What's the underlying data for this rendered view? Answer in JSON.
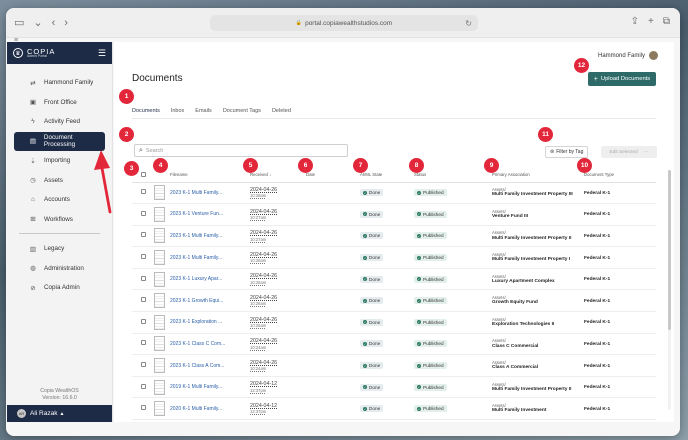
{
  "browser": {
    "url": "portal.copiawealthstudios.com"
  },
  "sidebar": {
    "brand": "COPIA",
    "brand_sub": "Admin Portal",
    "items": [
      {
        "label": "Hammond Family",
        "icon": "arrows-swap-icon"
      },
      {
        "label": "Front Office",
        "icon": "briefcase-icon"
      },
      {
        "label": "Activity Feed",
        "icon": "activity-icon"
      },
      {
        "label": "Document Processing",
        "icon": "document-icon",
        "active": true
      },
      {
        "label": "Importing",
        "icon": "import-icon"
      },
      {
        "label": "Assets",
        "icon": "clock-icon"
      },
      {
        "label": "Accounts",
        "icon": "bank-icon"
      },
      {
        "label": "Workflows",
        "icon": "workflow-icon"
      },
      {
        "label": "Legacy",
        "icon": "book-icon"
      },
      {
        "label": "Administration",
        "icon": "globe-icon"
      },
      {
        "label": "Copia Admin",
        "icon": "compass-icon"
      }
    ],
    "version_line1": "Copia WealthOS",
    "version_line2": "Version: 16.6.0",
    "user_name": "Ali Razak",
    "user_initials": "AR"
  },
  "header": {
    "user": "Hammond Family"
  },
  "main": {
    "title": "Documents",
    "upload_label": "Upload Documents",
    "tabs": [
      "Documents",
      "Inbox",
      "Emails",
      "Document Tags",
      "Deleted"
    ],
    "search_placeholder": "Search",
    "filter_label": "Filter by Tag",
    "edit_label": "Edit Selected"
  },
  "table": {
    "columns": [
      "Filename",
      "Received",
      "Date",
      "AI/ML State",
      "Status",
      "Primary Association",
      "Document Type"
    ],
    "rows": [
      {
        "filename": "2023 K-1 Multi Family...",
        "date": "2024-04-26",
        "time": "10:28am",
        "state": "Done",
        "status": "Published",
        "assoc_type": "Assets/",
        "assoc_name": "Multi Family Investment Property III",
        "doc_type": "Federal K-1"
      },
      {
        "filename": "2023 K-1 Venture Fun...",
        "date": "2024-04-26",
        "time": "10:27am",
        "state": "Done",
        "status": "Published",
        "assoc_type": "Assets/",
        "assoc_name": "Venture Fund III",
        "doc_type": "Federal K-1"
      },
      {
        "filename": "2023 K-1 Multi Family...",
        "date": "2024-04-26",
        "time": "10:27am",
        "state": "Done",
        "status": "Published",
        "assoc_type": "Assets/",
        "assoc_name": "Multi Family Investment Property II",
        "doc_type": "Federal K-1"
      },
      {
        "filename": "2023 K-1 Multi Family...",
        "date": "2024-04-26",
        "time": "10:26am",
        "state": "Done",
        "status": "Published",
        "assoc_type": "Assets/",
        "assoc_name": "Multi Family Investment Property I",
        "doc_type": "Federal K-1"
      },
      {
        "filename": "2023 K-1 Luxury Apar...",
        "date": "2024-04-26",
        "time": "10:26am",
        "state": "Done",
        "status": "Published",
        "assoc_type": "Assets/",
        "assoc_name": "Luxury Apartment Complex",
        "doc_type": "Federal K-1"
      },
      {
        "filename": "2023 K-1 Growth Equi...",
        "date": "2024-04-26",
        "time": "10:26am",
        "state": "Done",
        "status": "Published",
        "assoc_type": "Assets/",
        "assoc_name": "Growth Equity Fund",
        "doc_type": "Federal K-1"
      },
      {
        "filename": "2023 K-1 Exploration ...",
        "date": "2024-04-26",
        "time": "10:25am",
        "state": "Done",
        "status": "Published",
        "assoc_type": "Assets/",
        "assoc_name": "Exploration Technologies II",
        "doc_type": "Federal K-1"
      },
      {
        "filename": "2023 K-1 Class C Com...",
        "date": "2024-04-26",
        "time": "10:24am",
        "state": "Done",
        "status": "Published",
        "assoc_type": "Assets/",
        "assoc_name": "Class C Commercial",
        "doc_type": "Federal K-1"
      },
      {
        "filename": "2023 K-1 Class A Com...",
        "date": "2024-04-26",
        "time": "10:24am",
        "state": "Done",
        "status": "Published",
        "assoc_type": "Assets/",
        "assoc_name": "Class A Commercial",
        "doc_type": "Federal K-1"
      },
      {
        "filename": "2019 K-1 Multi Family...",
        "date": "2024-04-12",
        "time": "12:37pm",
        "state": "Done",
        "status": "Published",
        "assoc_type": "Assets/",
        "assoc_name": "Multi Family Investment Property II",
        "doc_type": "Federal K-1"
      },
      {
        "filename": "2020 K-1 Multi Family...",
        "date": "2024-04-12",
        "time": "12:37pm",
        "state": "Done",
        "status": "Published",
        "assoc_type": "Assets/",
        "assoc_name": "Multi Family Investment",
        "doc_type": "Federal K-1"
      }
    ]
  },
  "annotations": [
    "1",
    "2",
    "3",
    "4",
    "5",
    "6",
    "7",
    "8",
    "9",
    "10",
    "11",
    "12"
  ]
}
